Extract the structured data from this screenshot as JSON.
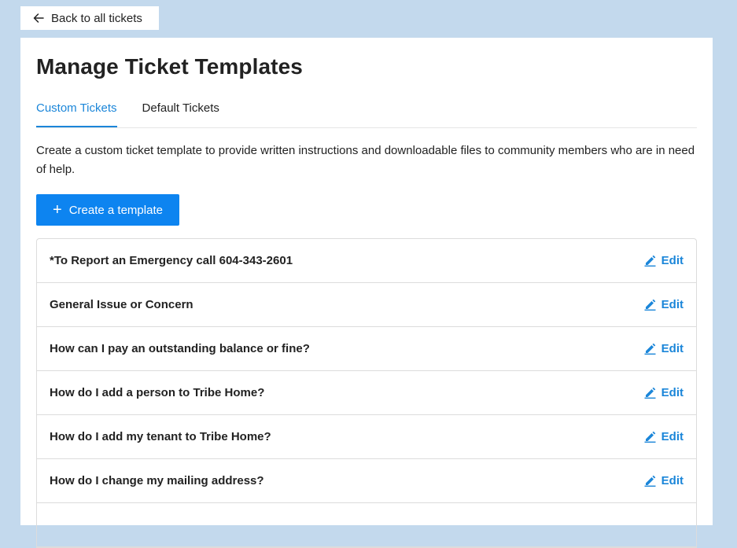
{
  "back_button": {
    "label": "Back to all tickets",
    "icon": "arrow-left-icon"
  },
  "page": {
    "title": "Manage Ticket Templates",
    "tabs": [
      {
        "label": "Custom Tickets",
        "active": true
      },
      {
        "label": "Default Tickets",
        "active": false
      }
    ],
    "description": "Create a custom ticket template to provide written instructions and downloadable files to community members who are in need of help.",
    "create_button": {
      "label": "Create a template",
      "icon": "plus-icon"
    }
  },
  "templates": {
    "edit_label": "Edit",
    "edit_icon": "pencil-icon",
    "items": [
      {
        "name": "*To Report an Emergency call 604-343-2601"
      },
      {
        "name": "General Issue or Concern"
      },
      {
        "name": "How can I pay an outstanding balance or fine?"
      },
      {
        "name": "How do I add a person to Tribe Home?"
      },
      {
        "name": "How do I add my tenant to Tribe Home?"
      },
      {
        "name": "How do I change my mailing address?"
      },
      {
        "name": ""
      }
    ]
  },
  "colors": {
    "background": "#c3d9ed",
    "accent": "#1b86d9",
    "primary_button": "#0d84f0"
  }
}
